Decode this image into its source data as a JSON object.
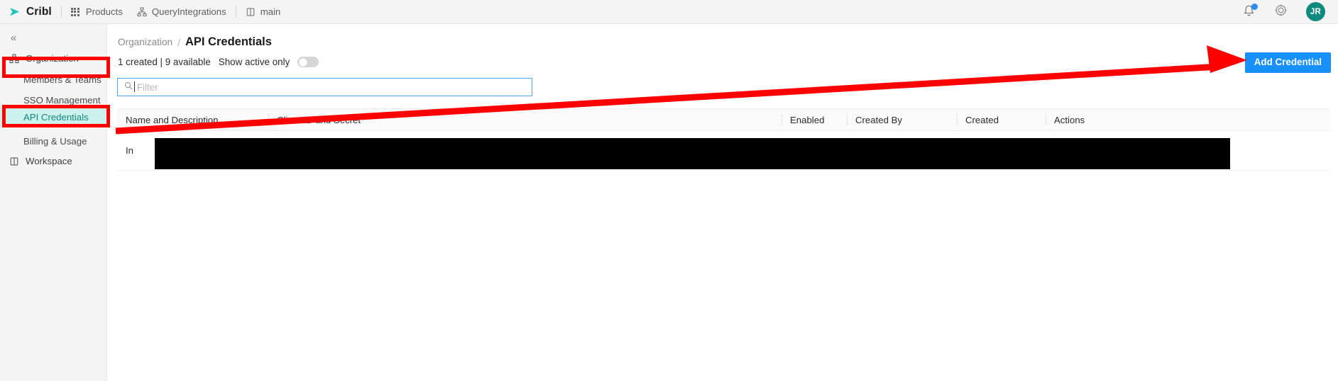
{
  "topnav": {
    "brand": "Cribl",
    "items": [
      {
        "label": "Products",
        "icon": "grid-icon"
      },
      {
        "label": "QueryIntegrations",
        "icon": "sitemap-icon"
      },
      {
        "label": "main",
        "icon": "book-icon"
      }
    ],
    "right": {
      "notifications_icon": "bell-icon",
      "help_icon": "gear-icon",
      "avatar_initials": "JR"
    }
  },
  "sidebar": {
    "collapse_icon": "«",
    "items": [
      {
        "label": "Organization",
        "icon": "sitemap-icon",
        "type": "top",
        "active": false
      },
      {
        "label": "Members & Teams",
        "icon": "",
        "type": "sub",
        "active": false
      },
      {
        "label": "SSO Management",
        "icon": "",
        "type": "sub",
        "active": false
      },
      {
        "label": "API Credentials",
        "icon": "",
        "type": "sub",
        "active": true
      },
      {
        "label": "Billing & Usage",
        "icon": "",
        "type": "sub",
        "active": false
      },
      {
        "label": "Workspace",
        "icon": "workspace-icon",
        "type": "top",
        "active": false
      }
    ]
  },
  "main": {
    "breadcrumb": {
      "parent": "Organization",
      "separator": "/",
      "current": "API Credentials"
    },
    "meta": {
      "counts": "1 created | 9 available",
      "toggle_label": "Show active only",
      "toggle_on": false
    },
    "filter": {
      "placeholder": "Filter",
      "value": "",
      "icon": "search-icon",
      "focused": true
    },
    "add_button": "Add Credential",
    "table": {
      "columns": [
        "Name and Description",
        "Client ID and Secret",
        "Enabled",
        "Created By",
        "Created",
        "Actions"
      ],
      "rows": [
        {
          "name": "In",
          "secret": "",
          "enabled": "",
          "created_by": "",
          "created": "",
          "actions_label": "•••",
          "redacted": true
        }
      ]
    }
  },
  "annotations": {
    "color": "#ff0000",
    "boxes": [
      {
        "target": "sidebar-item-organization"
      },
      {
        "target": "sidebar-item-api-credentials"
      }
    ],
    "arrow": {
      "from": "sidebar-item-api-credentials",
      "to": "add-credential-button"
    }
  }
}
